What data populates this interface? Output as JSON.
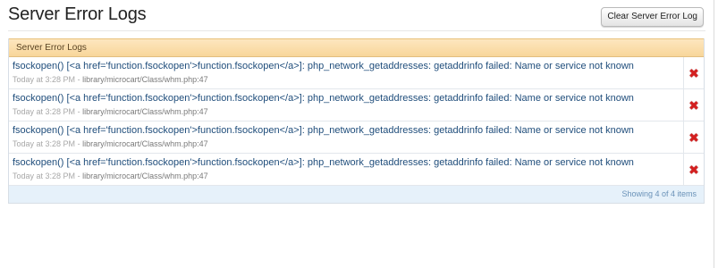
{
  "page": {
    "title": "Server Error Logs"
  },
  "toolbar": {
    "clear_label": "Clear Server Error Log"
  },
  "panel": {
    "header": "Server Error Logs",
    "footer": "Showing 4 of 4 items"
  },
  "logs": [
    {
      "message": "fsockopen() [<a href='function.fsockopen'>function.fsockopen</a>]: php_network_getaddresses: getaddrinfo failed: Name or service not known",
      "time": "Today at 3:28 PM",
      "separator": "-",
      "path": "library/microcart/Class/whm.php:47"
    },
    {
      "message": "fsockopen() [<a href='function.fsockopen'>function.fsockopen</a>]: php_network_getaddresses: getaddrinfo failed: Name or service not known",
      "time": "Today at 3:28 PM",
      "separator": "-",
      "path": "library/microcart/Class/whm.php:47"
    },
    {
      "message": "fsockopen() [<a href='function.fsockopen'>function.fsockopen</a>]: php_network_getaddresses: getaddrinfo failed: Name or service not known",
      "time": "Today at 3:28 PM",
      "separator": "-",
      "path": "library/microcart/Class/whm.php:47"
    },
    {
      "message": "fsockopen() [<a href='function.fsockopen'>function.fsockopen</a>]: php_network_getaddresses: getaddrinfo failed: Name or service not known",
      "time": "Today at 3:28 PM",
      "separator": "-",
      "path": "library/microcart/Class/whm.php:47"
    }
  ],
  "icons": {
    "delete": "close-x-icon"
  },
  "colors": {
    "header_bg": "#f8d69a",
    "message_text": "#1f4d7b",
    "delete_red": "#d41f1f",
    "footer_bg": "#e6f1fa"
  }
}
